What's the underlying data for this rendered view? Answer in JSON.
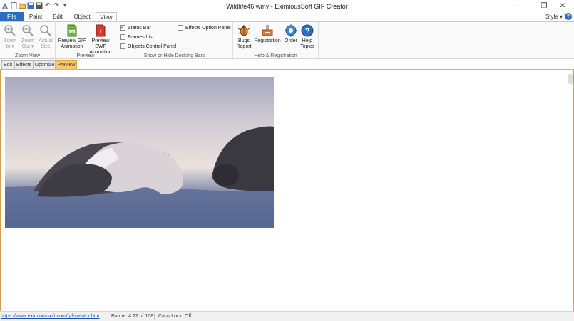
{
  "window": {
    "title": "Wildlife46.wmv - EximiousSoft GIF Creator",
    "controls": {
      "minimize": "—",
      "maximize": "❐",
      "close": "✕"
    }
  },
  "qat": {
    "icons": [
      "app-icon",
      "new-icon",
      "open-icon",
      "save-icon",
      "saveas-icon",
      "undo-icon",
      "redo-icon",
      "customize-icon"
    ]
  },
  "tabs": {
    "file": "File",
    "items": [
      "Paint",
      "Edit",
      "Object",
      "View"
    ],
    "active": "View",
    "style_menu": "Style ▾",
    "help": "?"
  },
  "ribbon": {
    "zoom_view": {
      "caption": "Zoom View",
      "zoom_in": [
        "Zoom",
        "In ▾"
      ],
      "zoom_out": [
        "Zoom",
        "Out ▾"
      ],
      "actual_size": [
        "Actual",
        "Size"
      ]
    },
    "preview": {
      "caption": "Preview",
      "preview_gif": [
        "Preview GIF",
        "Animation"
      ],
      "preview_swf": [
        "Preview SWF",
        "Animation"
      ]
    },
    "docking": {
      "caption": "Show or Hide Docking Bars",
      "status_bar": {
        "label": "Status Bar",
        "checked": true
      },
      "frames_list": {
        "label": "Frames List",
        "checked": false
      },
      "objects_panel": {
        "label": "Objects Control Panel",
        "checked": false
      },
      "effects_panel": {
        "label": "Effects Option Panel",
        "checked": false
      }
    },
    "help_reg": {
      "caption": "Help & Registration",
      "bugs": [
        "Bugs",
        "Report"
      ],
      "registration": "Registration",
      "order": "Order",
      "help_topics": [
        "Help",
        "Topics"
      ]
    }
  },
  "doc_tabs": {
    "items": [
      "Edit",
      "Effects",
      "Optimize",
      "Preview"
    ],
    "active": "Preview"
  },
  "status_bar": {
    "url": "https://www.eximioussoft.com/gif-creator.htm",
    "frame": "Frame: # 22 of 108",
    "caps_lock": "Caps Lock: Off"
  },
  "colors": {
    "accent_blue": "#2b6cc4",
    "active_doc_tab": "#f7c96b"
  }
}
